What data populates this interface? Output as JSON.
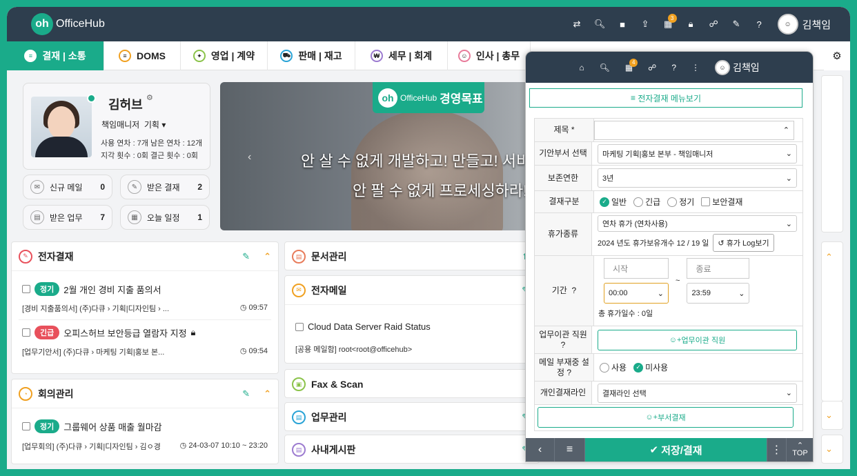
{
  "app": {
    "logo_mark": "oh",
    "logo_text": "OfficeHub",
    "user_name": "김책임",
    "calendar_badge": "3"
  },
  "topbar_icons": [
    "exchange-icon",
    "search-icon",
    "video-icon",
    "share-icon",
    "calendar-icon",
    "lock-icon",
    "org-chart-icon",
    "edit-icon",
    "help-icon"
  ],
  "tabs": [
    {
      "label": "결재 | 소통",
      "active": true
    },
    {
      "label": "DOMS"
    },
    {
      "label": "영업 | 계약"
    },
    {
      "label": "판매 | 재고"
    },
    {
      "label": "세무 | 회계"
    },
    {
      "label": "인사 | 총무"
    }
  ],
  "profile": {
    "name": "김허브",
    "role": "책임매니저",
    "dept": "기획",
    "leave_line": "사용 연차 : 7개  남은 연차 : 12개",
    "late_line": "지각 횟수 : 0회  결근 횟수 : 0회"
  },
  "quick": [
    {
      "label": "신규 메일",
      "count": "0"
    },
    {
      "label": "받은 결재",
      "count": "2"
    },
    {
      "label": "받은 업무",
      "count": "7"
    },
    {
      "label": "오늘 일정",
      "count": "1"
    }
  ],
  "banner": {
    "logo_mark": "oh",
    "logo_text": "OfficeHub",
    "title": "경영목표",
    "line1": "안 살 수 없게 개발하고! 만들고! 서비스",
    "line2": "안 팔 수 없게 프로세싱하라!"
  },
  "approval": {
    "title": "전자결재",
    "items": [
      {
        "tag": "정기",
        "tag_color": "#1aab8a",
        "title": "2월 개인 경비 지출 품의서",
        "sub": "[경비 지출품의서] (주)다큐 › 기획|디자인팀 › ...",
        "time": "09:57"
      },
      {
        "tag": "긴급",
        "tag_color": "#e8505b",
        "title": "오피스허브 보안등급 열람자 지정",
        "sub": "[업무기안서] (주)다큐 › 마케팅 기획|홍보 본...",
        "time": "09:54"
      }
    ]
  },
  "meeting": {
    "title": "회의관리",
    "items": [
      {
        "tag": "정기",
        "tag_color": "#1aab8a",
        "title": "그룹웨어 상품 매출 월마감",
        "sub": "[업무회의] (주)다큐 › 기획|디자인팀 › 김ㅇ경",
        "time": "24-03-07 10:10 ~ 23:20"
      }
    ]
  },
  "docs": {
    "title": "문서관리"
  },
  "mail": {
    "title": "전자메일",
    "item_title": "Cloud Data Server Raid Status",
    "item_sub": "[공용 메일함] root<root@officehub>"
  },
  "fax": {
    "title": "Fax & Scan"
  },
  "work": {
    "title": "업무관리"
  },
  "board": {
    "title": "사내게시판"
  },
  "popup": {
    "user_name": "김책임",
    "badge": "4",
    "menu_label": "전자결재 메뉴보기",
    "fields": {
      "title_label": "제목 *",
      "dept_label": "기안부서 선택",
      "dept_value": "마케팅 기획|홍보 본부 - 책임매니저",
      "keep_label": "보존연한",
      "keep_value": "3년",
      "type_label": "결재구분",
      "type_options": [
        "일반",
        "긴급",
        "정기"
      ],
      "type_checkbox": "보안결재",
      "leave_label": "휴가종류",
      "leave_value": "연차 휴가 (연차사용)",
      "leave_count": "2024 년도 휴가보유개수 12 / 19 일",
      "leave_log": "휴가 Log보기",
      "period_label": "기간",
      "start_ph": "시작",
      "end_ph": "종료",
      "start_time": "00:00",
      "end_time": "23:59",
      "tilde": "~",
      "total": "총 휴가일수 : 0일",
      "transfer_label": "업무이관 직원",
      "transfer_btn": "업무이관 직원",
      "absence_label": "메일 부재중 설정",
      "absence_options": [
        "사용",
        "미사용"
      ],
      "line_label": "개인결재라인",
      "line_value": "결재라인 선택",
      "dept_btn": "부서결재"
    },
    "bottom": {
      "save": "저장/결재",
      "top": "TOP"
    }
  },
  "colors": {
    "accent": "#1aab8a",
    "dark": "#2e3e4e",
    "warn": "#f0a020",
    "urgent": "#e8505b"
  }
}
